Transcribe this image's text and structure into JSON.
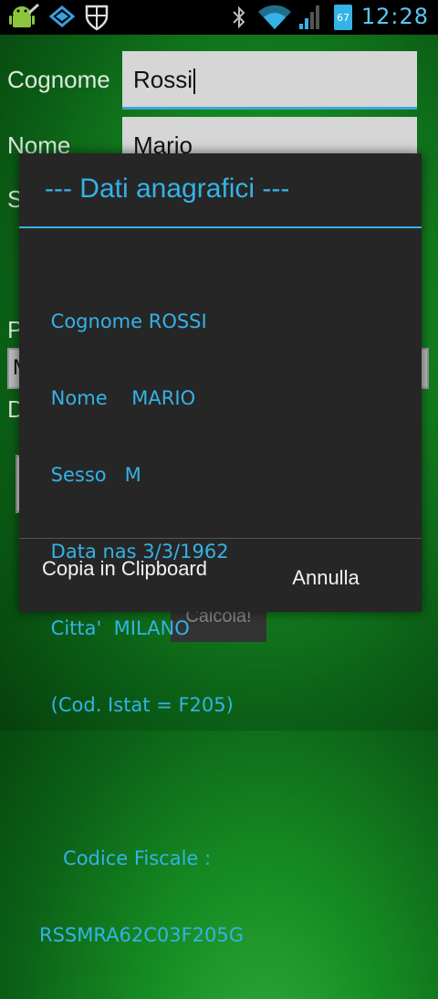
{
  "status_bar": {
    "time": "12:28",
    "battery_level": "67",
    "icons": [
      "android-debug-icon",
      "dropbox-icon",
      "shield-icon",
      "bluetooth-icon",
      "wifi-icon",
      "signal-icon",
      "battery-icon"
    ]
  },
  "form": {
    "cognome_label": "Cognome",
    "cognome_value": "Rossi",
    "nome_label": "Nome",
    "nome_value": "Mario",
    "sesso_label_partial": "S",
    "luogo_label_partial": "P",
    "luogo_value_partial": "M",
    "data_label_partial": "D",
    "calcola_label": "Calcola!"
  },
  "dialog": {
    "title": "--- Dati anagrafici ---",
    "lines": [
      " Cognome ROSSI",
      " Nome    MARIO",
      " Sesso   M",
      " Data nas 3/3/1962",
      " Citta'  MILANO",
      " (Cod. Istat = F205)",
      "",
      "   Codice Fiscale :",
      "RSSMRA62C03F205G"
    ],
    "copy_button": "Copia in Clipboard",
    "cancel_button": "Annulla"
  },
  "colors": {
    "accent": "#35b2e6",
    "dialog_bg": "#262626",
    "statusbar_bg": "#000000"
  }
}
